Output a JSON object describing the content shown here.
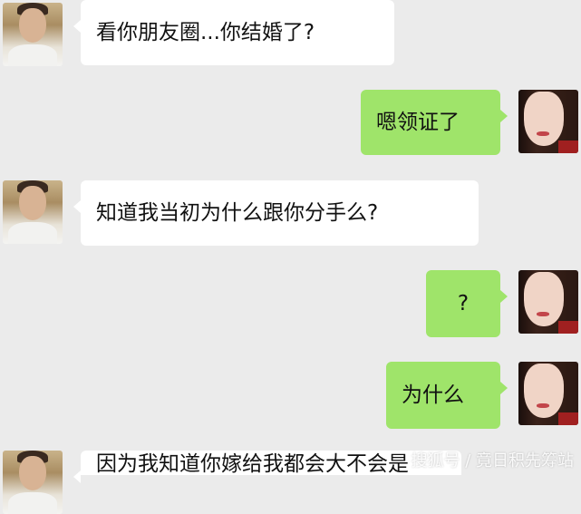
{
  "colors": {
    "background": "#ebebeb",
    "incoming_bubble": "#ffffff",
    "outgoing_bubble": "#9fe46a"
  },
  "messages": [
    {
      "side": "in",
      "text": "看你朋友圈...你结婚了?"
    },
    {
      "side": "out",
      "text": "嗯领证了"
    },
    {
      "side": "in",
      "text": "知道我当初为什么跟你分手么?"
    },
    {
      "side": "out",
      "text": "?"
    },
    {
      "side": "out",
      "text": "为什么"
    },
    {
      "side": "in",
      "text": "因为我知道你嫁给我都会大不会是"
    }
  ],
  "watermark": "搜狐号 / 竟日积先筹站"
}
